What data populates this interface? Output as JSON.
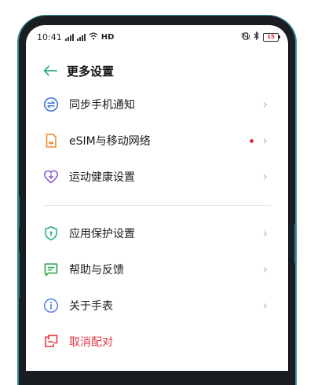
{
  "status_bar": {
    "time": "10:41",
    "left_icons": [
      "signal-icon",
      "signal-icon",
      "wifi-icon"
    ],
    "network_label": "HD",
    "right_icons": [
      "vibrate-icon",
      "bluetooth-icon"
    ],
    "battery": "15"
  },
  "header": {
    "back_icon": "arrow-left-icon",
    "title": "更多设置"
  },
  "items": [
    {
      "label": "同步手机通知",
      "icon": "sync-icon",
      "color": "#3d78d8"
    },
    {
      "label": "eSIM与移动网络",
      "icon": "sim-card-icon",
      "color": "#ec8a2f",
      "badge": true
    },
    {
      "label": "运动健康设置",
      "icon": "heart-plus-icon",
      "color": "#8a5ad9"
    },
    {
      "label": "应用保护设置",
      "icon": "shield-icon",
      "color": "#2eb08e"
    },
    {
      "label": "帮助与反馈",
      "icon": "feedback-icon",
      "color": "#2aa64d"
    },
    {
      "label": "关于手表",
      "icon": "info-icon",
      "color": "#5b87d9"
    },
    {
      "label": "取消配对",
      "icon": "unpair-icon",
      "color": "#e6343f"
    }
  ],
  "colors": {
    "accent": "#2dab7e",
    "danger": "#e6343f",
    "badge": "#e2303d"
  }
}
